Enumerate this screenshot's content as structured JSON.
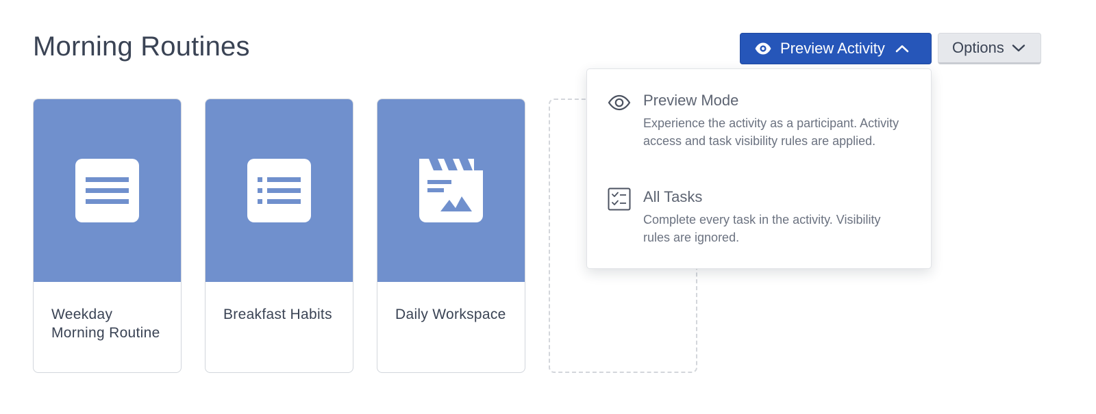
{
  "page": {
    "title": "Morning Routines"
  },
  "header": {
    "preview_button": {
      "label": "Preview Activity",
      "icon": "eye-icon",
      "chevron": "chevron-up-icon"
    },
    "options_button": {
      "label": "Options",
      "chevron": "chevron-down-icon"
    }
  },
  "cards": [
    {
      "label": "Weekday Morning Routine",
      "icon": "page-icon"
    },
    {
      "label": "Breakfast Habits",
      "icon": "list-icon"
    },
    {
      "label": "Daily Workspace",
      "icon": "media-icon"
    }
  ],
  "preview_menu": {
    "items": [
      {
        "title": "Preview Mode",
        "description": "Experience the activity as a participant. Activity access and task visibility rules are applied.",
        "icon": "eye-icon"
      },
      {
        "title": "All Tasks",
        "description": "Complete every task in the activity. Visibility rules are ignored.",
        "icon": "checklist-icon"
      }
    ]
  },
  "colors": {
    "primary": "#2656b9",
    "card_cover": "#7090cd",
    "text": "#3a4354"
  }
}
